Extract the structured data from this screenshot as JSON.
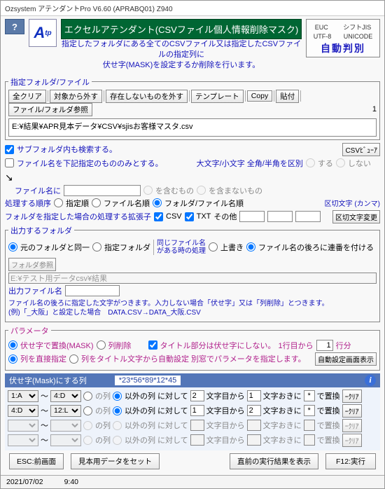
{
  "window": {
    "title": "Ozsystem アテンダントPro V6.60 (APRABQ01)  Z940"
  },
  "header": {
    "green_title": "エクセルアテンダント(CSVファイル個人情報削除マスク)",
    "desc1": "指定したフォルダにある全てのCSVファイル又は指定したCSVファイルの指定列に",
    "desc2": "伏せ字(MASK)を設定するか削除を行います。"
  },
  "enc": {
    "e1": "EUC",
    "e2": "シフトJIS",
    "e3": "UTF-8",
    "e4": "UNICODE",
    "auto": "自動判別"
  },
  "folder": {
    "legend": "指定フォルダ/ファイル",
    "b_clear": "全クリア",
    "b_remove": "対象から外す",
    "b_missing": "存在しないものを外す",
    "b_template": "テンプレート",
    "b_copy": "Copy",
    "b_paste": "貼付",
    "b_browse": "ファイル/フォルダ参照",
    "count": "1",
    "path": "E:¥結果¥APR見本データ¥CSV¥sjisお客様マスタ.csv"
  },
  "opts": {
    "subfolder": "サブフォルダ内も検索する。",
    "limitname": "ファイル名を下記指定のもののみとする。",
    "case_label": "大文字/小文字 全角/半角を区別",
    "case_yes": "する",
    "case_no": "しない",
    "csv_viewer": "CSVﾋﾞｭｰｱ",
    "filename_label": "ファイル名に",
    "contain": "を含むもの",
    "not_contain": "を含まないもの",
    "order_label": "処理する順序",
    "ord_spec": "指定順",
    "ord_file": "ファイル名順",
    "ord_folder": "フォルダ/ファイル名順",
    "ext_label": "フォルダを指定した場合の処理する拡張子",
    "ext_csv": "CSV",
    "ext_txt": "TXT",
    "ext_other": "その他",
    "delim_label": "区切文字 (カンマ)",
    "delim_btn": "区切文字変更"
  },
  "out": {
    "legend": "出力するフォルダ",
    "same": "元のフォルダと同一",
    "spec": "指定フォルダ",
    "same_on_dup_l1": "同じファイル名",
    "same_on_dup_l2": "がある時の処理",
    "overwrite": "上書き",
    "seq": "ファイル名の後ろに連番を付ける",
    "folder_btn": "フォルダ参照",
    "path": "E:¥テスト用データcsv¥結果",
    "filename_label": "出力ファイル名",
    "desc1": "ファイル名の後ろに指定した文字がつきます。入力しない場合「伏せ字」又は「列削除」とつきます。",
    "desc2": "(例)「_大阪」と設定した場合　DATA.CSV→DATA_大阪.CSV"
  },
  "param": {
    "legend": "パラメータ",
    "mask": "伏せ字で置換(MASK)",
    "delcol": "列削除",
    "title_keep": "タイトル部分は伏せ字にしない。",
    "line_from": "1行目から",
    "line_num": "1",
    "line_unit": "行分",
    "direct": "列を直接指定",
    "auto": "列をタイトル文字から自動設定 別窓でパラメータを指定します。",
    "auto_btn": "自動設定画面表示"
  },
  "mask": {
    "banner": "伏せ字(Mask)にする列",
    "sample": "*23*56*89*12*45",
    "tilde": "〜",
    "col_opt1": "の列",
    "col_opt2": "以外の列",
    "apply": "に対して",
    "from_char": "文字目から",
    "every": "文字おきに",
    "repl": "で置換",
    "clear": "ｰｸﾘｱ",
    "r1_a": "1:A",
    "r1_b": "4:D",
    "r1_n1": "2",
    "r1_n2": "1",
    "r1_c": "*",
    "r2_a": "4:D",
    "r2_b": "12:L",
    "r2_n1": "1",
    "r2_n2": "2",
    "r2_c": "*"
  },
  "footer": {
    "esc": "ESC:前画面",
    "sample": "見本用データをセット",
    "prev": "直前の実行結果を表示",
    "run": "F12:実行"
  },
  "status": {
    "date": "2021/07/02",
    "time": "9:40"
  }
}
